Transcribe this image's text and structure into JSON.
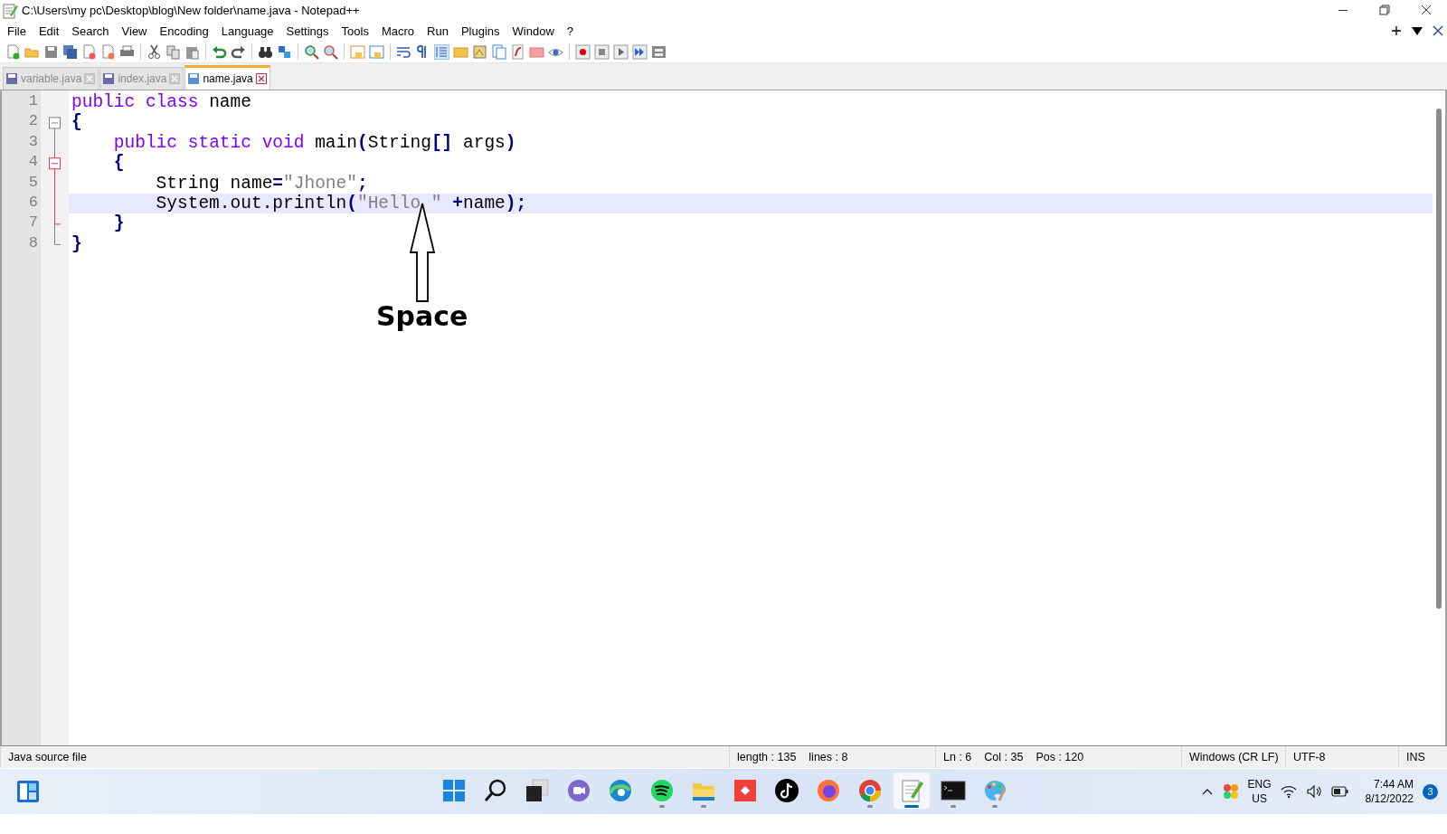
{
  "window": {
    "title": "C:\\Users\\my pc\\Desktop\\blog\\New folder\\name.java - Notepad++"
  },
  "menu": [
    "File",
    "Edit",
    "Search",
    "View",
    "Encoding",
    "Language",
    "Settings",
    "Tools",
    "Macro",
    "Run",
    "Plugins",
    "Window",
    "?"
  ],
  "tabs": [
    {
      "label": "variable.java",
      "selected": false
    },
    {
      "label": "index.java",
      "selected": false
    },
    {
      "label": "name.java",
      "selected": true
    }
  ],
  "editor": {
    "lines": [
      {
        "number": "1",
        "current": false,
        "fold_toggle": false,
        "tokens": [
          {
            "kind": "kw",
            "text": "public"
          },
          {
            "kind": "kw",
            "text": " class"
          },
          {
            "kind": "plain",
            "text": " name"
          }
        ]
      },
      {
        "number": "2",
        "current": false,
        "fold_toggle": true,
        "tokens": [
          {
            "kind": "op",
            "text": "{"
          }
        ]
      },
      {
        "number": "3",
        "current": false,
        "fold_toggle": false,
        "tokens": [
          {
            "kind": "kw",
            "text": "    public"
          },
          {
            "kind": "kw",
            "text": " static"
          },
          {
            "kind": "kw",
            "text": " void"
          },
          {
            "kind": "plain",
            "text": " main"
          },
          {
            "kind": "op",
            "text": "("
          },
          {
            "kind": "plain",
            "text": "String"
          },
          {
            "kind": "op",
            "text": "[]"
          },
          {
            "kind": "plain",
            "text": " args"
          },
          {
            "kind": "op",
            "text": ")"
          }
        ]
      },
      {
        "number": "4",
        "current": false,
        "fold_toggle": true,
        "tokens": [
          {
            "kind": "op",
            "text": "    {"
          }
        ]
      },
      {
        "number": "5",
        "current": false,
        "fold_toggle": false,
        "tokens": [
          {
            "kind": "plain",
            "text": "        String name"
          },
          {
            "kind": "op",
            "text": "="
          },
          {
            "kind": "str",
            "text": "\"Jhone\""
          },
          {
            "kind": "op",
            "text": ";"
          }
        ]
      },
      {
        "number": "6",
        "current": true,
        "fold_toggle": false,
        "tokens": [
          {
            "kind": "plain",
            "text": "        System.out.println"
          },
          {
            "kind": "op",
            "text": "("
          },
          {
            "kind": "str",
            "text": "\"Hello \""
          },
          {
            "kind": "op",
            "text": " +"
          },
          {
            "kind": "plain",
            "text": "name"
          },
          {
            "kind": "op",
            "text": ");"
          }
        ]
      },
      {
        "number": "7",
        "current": false,
        "fold_toggle": false,
        "tokens": [
          {
            "kind": "op",
            "text": "    }"
          }
        ]
      },
      {
        "number": "8",
        "current": false,
        "fold_toggle": false,
        "tokens": [
          {
            "kind": "op",
            "text": "}"
          }
        ]
      }
    ]
  },
  "annotation": {
    "label": "Space"
  },
  "status_bar": {
    "file_type": "Java source file",
    "length": "length : 135",
    "lines": "lines : 8",
    "ln": "Ln : 6",
    "col": "Col : 35",
    "pos": "Pos : 120",
    "eol": "Windows (CR LF)",
    "encoding": "UTF-8",
    "mode": "INS"
  },
  "taskbar": {
    "apps": [
      {
        "kind": "start",
        "running": false,
        "selected": false
      },
      {
        "kind": "search",
        "running": false,
        "selected": false
      },
      {
        "kind": "taskview",
        "running": false,
        "selected": false
      },
      {
        "kind": "chat",
        "running": false,
        "selected": false
      },
      {
        "kind": "edge",
        "running": false,
        "selected": false
      },
      {
        "kind": "spotify",
        "running": true,
        "selected": false
      },
      {
        "kind": "folder",
        "running": true,
        "selected": false
      },
      {
        "kind": "redapp",
        "running": false,
        "selected": false
      },
      {
        "kind": "tiktok",
        "running": false,
        "selected": false
      },
      {
        "kind": "firefox",
        "running": false,
        "selected": false
      },
      {
        "kind": "chrome",
        "running": true,
        "selected": false
      },
      {
        "kind": "notepad",
        "running": true,
        "selected": true
      },
      {
        "kind": "terminal",
        "running": true,
        "selected": false
      },
      {
        "kind": "paint",
        "running": true,
        "selected": false
      }
    ],
    "tray": {
      "language": "ENG",
      "region": "US",
      "time": "7:44 AM",
      "date": "8/12/2022",
      "notifications": "3"
    }
  }
}
